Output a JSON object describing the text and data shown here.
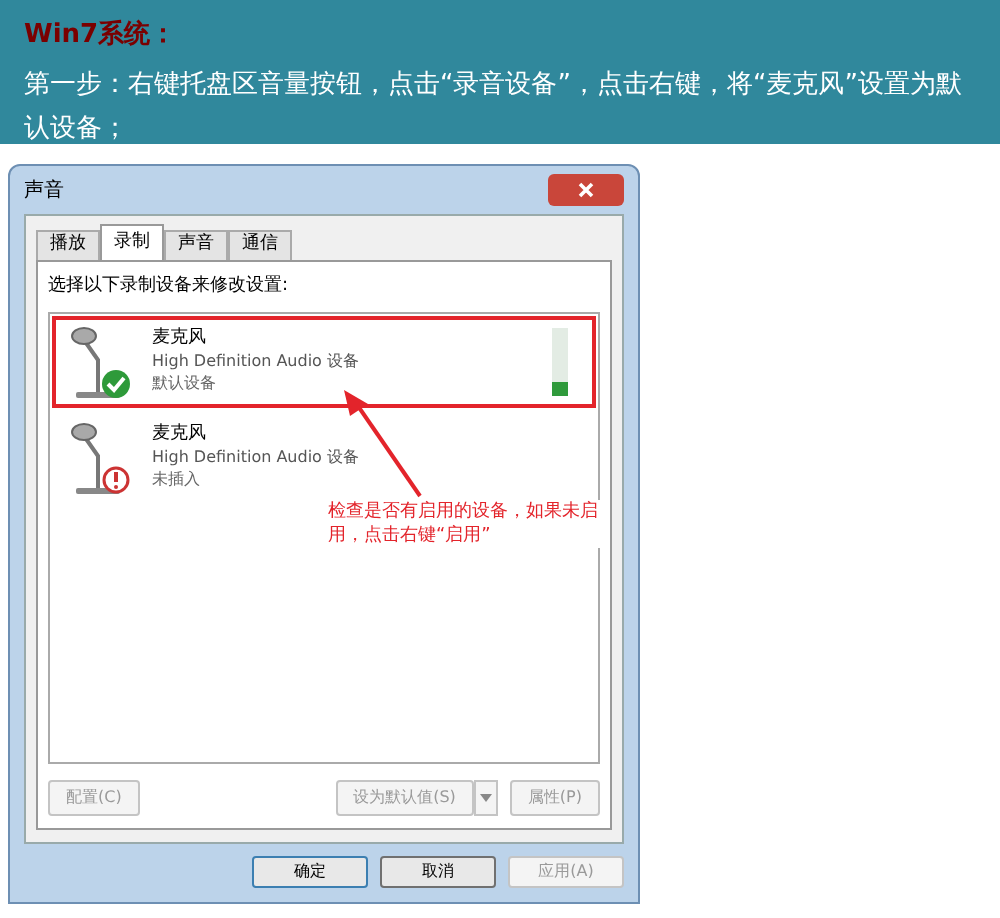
{
  "banner": {
    "heading": "Win7系统：",
    "text": "第一步：右键托盘区音量按钮，点击“录音设备”，点击右键，将“麦克风”设置为默认设备；"
  },
  "window": {
    "title": "声音"
  },
  "tabs": [
    {
      "label": "播放",
      "selected": false
    },
    {
      "label": "录制",
      "selected": true
    },
    {
      "label": "声音",
      "selected": false
    },
    {
      "label": "通信",
      "selected": false
    }
  ],
  "instruction": "选择以下录制设备来修改设置:",
  "devices": [
    {
      "name": "麦克风",
      "driver": "High Definition Audio 设备",
      "status": "默认设备",
      "kind": "default",
      "selected": true,
      "level": 0.2
    },
    {
      "name": "麦克风",
      "driver": "High Definition Audio 设备",
      "status": "未插入",
      "kind": "unplugged",
      "selected": false
    }
  ],
  "list_buttons": [
    {
      "label": "配置(C)",
      "disabled": true
    },
    {
      "label": "设为默认值(S)",
      "disabled": true,
      "kind": "split"
    },
    {
      "label": "属性(P)",
      "disabled": true
    }
  ],
  "dialog_buttons": [
    {
      "label": "确定",
      "disabled": false,
      "selected": true
    },
    {
      "label": "取消",
      "disabled": false,
      "selected": false
    },
    {
      "label": "应用(A)",
      "disabled": true,
      "selected": false
    }
  ],
  "annotation": "检查是否有启用的设备，如果未启用，点击右键“启用”"
}
